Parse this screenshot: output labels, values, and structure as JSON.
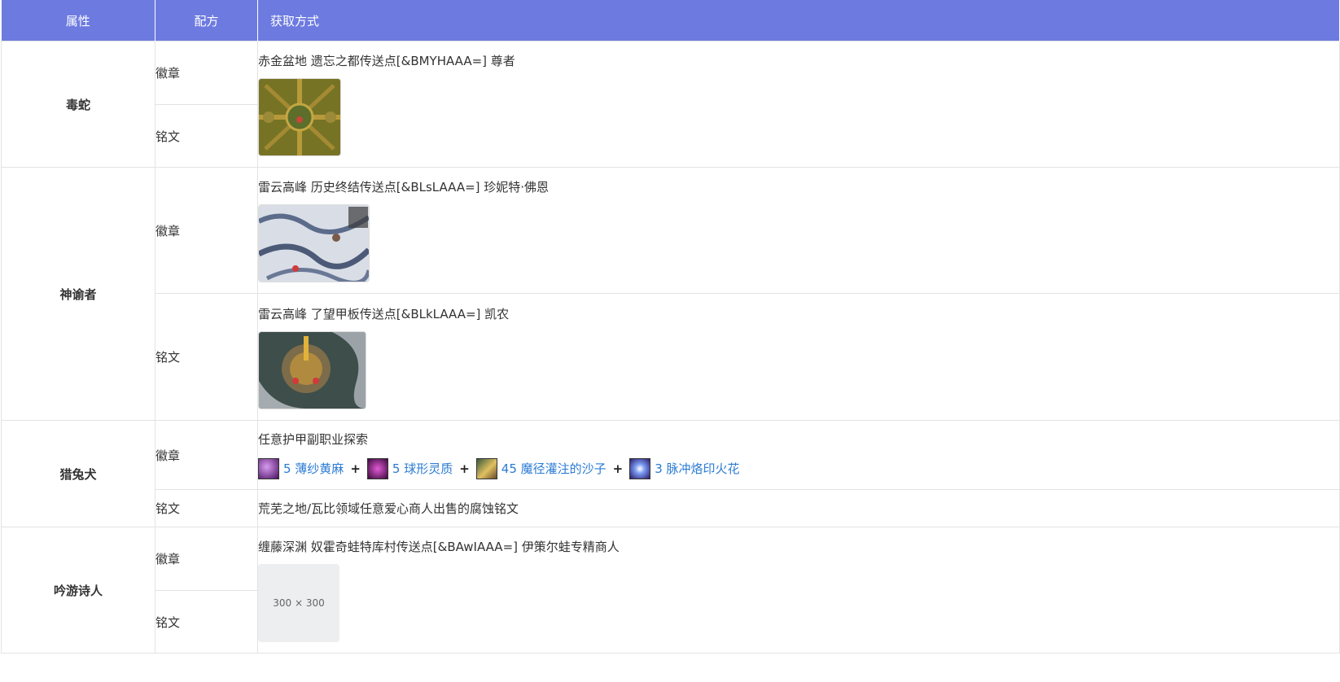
{
  "headers": {
    "attribute": "属性",
    "recipe": "配方",
    "method": "获取方式"
  },
  "rows": {
    "viper": {
      "attribute": "毒蛇",
      "recipe_a": "徽章",
      "recipe_b": "铭文",
      "method": "赤金盆地 遗忘之都传送点[&BMYHAAA=] 尊者"
    },
    "oracle": {
      "attribute": "神谕者",
      "recipe_a": "徽章",
      "method_a": "雷云高峰 历史终结传送点[&BLsLAAA=] 珍妮特·佛恩",
      "recipe_b": "铭文",
      "method_b": "雷云高峰 了望甲板传送点[&BLkLAAA=] 凯农"
    },
    "hound": {
      "attribute": "猎兔犬",
      "recipe_a": "徽章",
      "method_a": "任意护甲副职业探索",
      "materials": [
        {
          "qty_name": "5 薄纱黄麻",
          "icon": "jute-icon",
          "color": "#7a2a9a"
        },
        {
          "qty_name": "5 球形灵质",
          "icon": "ectoplasm-icon",
          "color": "#8b1f8f"
        },
        {
          "qty_name": "45 魔径灌注的沙子",
          "icon": "sand-icon",
          "color": "#c9a24a"
        },
        {
          "qty_name": "3 脉冲烙印火花",
          "icon": "spark-icon",
          "color": "#3a55c9"
        }
      ],
      "plus": "+",
      "recipe_b": "铭文",
      "method_b": "荒芜之地/瓦比领域任意爱心商人出售的腐蚀铭文"
    },
    "minstrel": {
      "attribute": "吟游诗人",
      "recipe_a": "徽章",
      "recipe_b": "铭文",
      "method": "缠藤深渊 奴霍奇蛙特库村传送点[&BAwIAAA=] 伊策尔蛙专精商人",
      "placeholder": "300 × 300"
    }
  }
}
